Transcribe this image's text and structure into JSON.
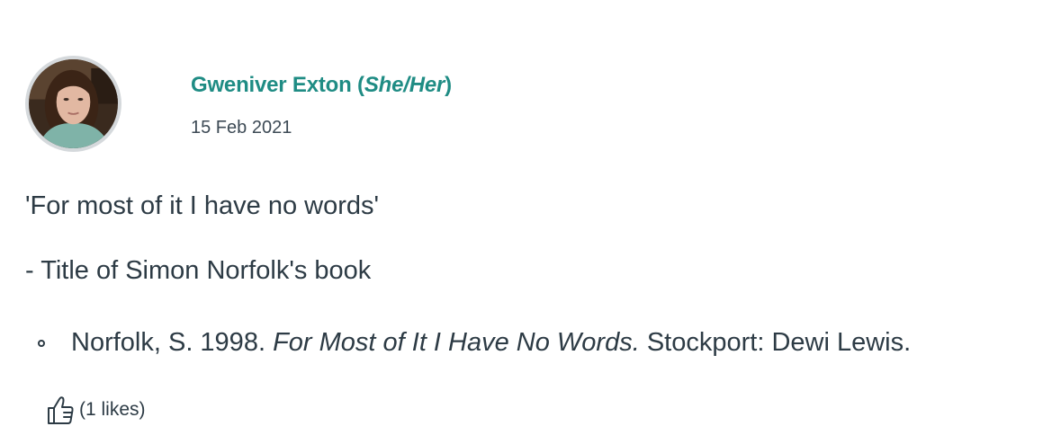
{
  "post": {
    "author_name": "Gweniver Exton",
    "pronouns_open": " (",
    "pronouns": "She/Her",
    "pronouns_close": ")",
    "date": "15 Feb 2021",
    "quote": "'For most of it I have no words'",
    "attribution": "- Title of Simon Norfolk's book",
    "reference": {
      "before": "Norfolk, S. 1998. ",
      "title": "For Most of It I Have No Words.",
      "after": " Stockport: Dewi Lewis."
    },
    "likes_text": "(1 likes)",
    "like_icon": "thumbs-up-icon"
  },
  "colors": {
    "author_link": "#1f8c84",
    "text": "#2d3b45",
    "avatar_ring": "#d5d9dc"
  }
}
